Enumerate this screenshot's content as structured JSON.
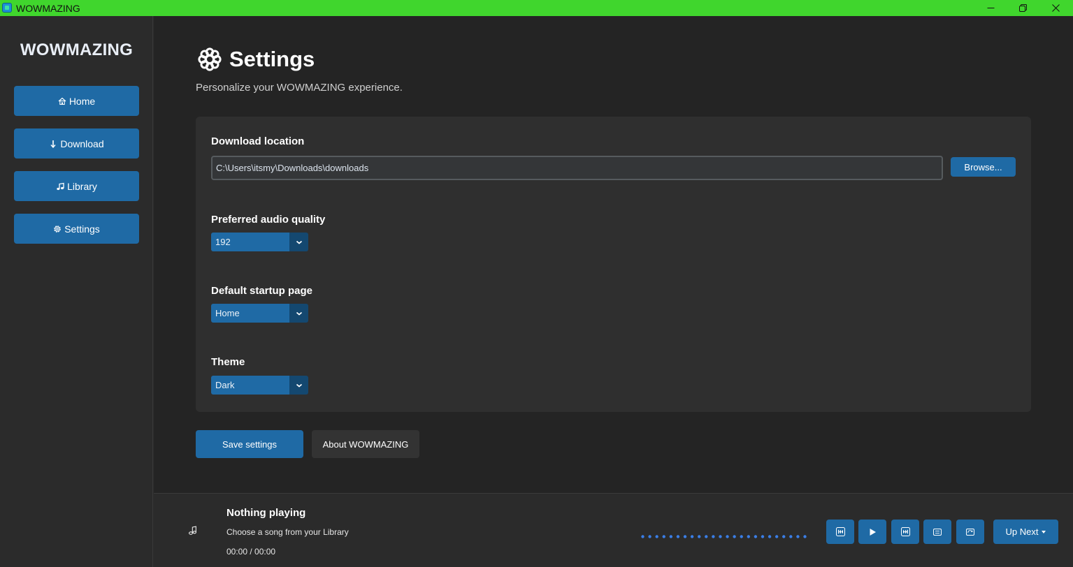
{
  "window": {
    "title": "WOWMAZING"
  },
  "sidebar": {
    "brand": "WOWMAZING",
    "items": [
      {
        "icon": "home-icon",
        "label": "Home"
      },
      {
        "icon": "download-icon",
        "label": "Download"
      },
      {
        "icon": "music-note-icon",
        "label": "Library"
      },
      {
        "icon": "gear-icon",
        "label": "Settings"
      }
    ]
  },
  "settings": {
    "title": "Settings",
    "subtitle": "Personalize your WOWMAZING experience.",
    "download_location": {
      "label": "Download location",
      "value": "C:\\Users\\itsmy\\Downloads\\downloads",
      "browse_label": "Browse..."
    },
    "audio_quality": {
      "label": "Preferred audio quality",
      "value": "192"
    },
    "startup_page": {
      "label": "Default startup page",
      "value": "Home"
    },
    "theme": {
      "label": "Theme",
      "value": "Dark"
    },
    "save_label": "Save settings",
    "about_label": "About WOWMAZING"
  },
  "player": {
    "title": "Nothing playing",
    "subtitle": "Choose a song from your Library",
    "time": "00:00 / 00:00",
    "up_next_label": "Up Next",
    "progress": 0
  },
  "colors": {
    "accent": "#1f6aa5",
    "accent_dark": "#144870",
    "titlebar": "#40d62d",
    "progress_dots": "#3a7ee6"
  }
}
